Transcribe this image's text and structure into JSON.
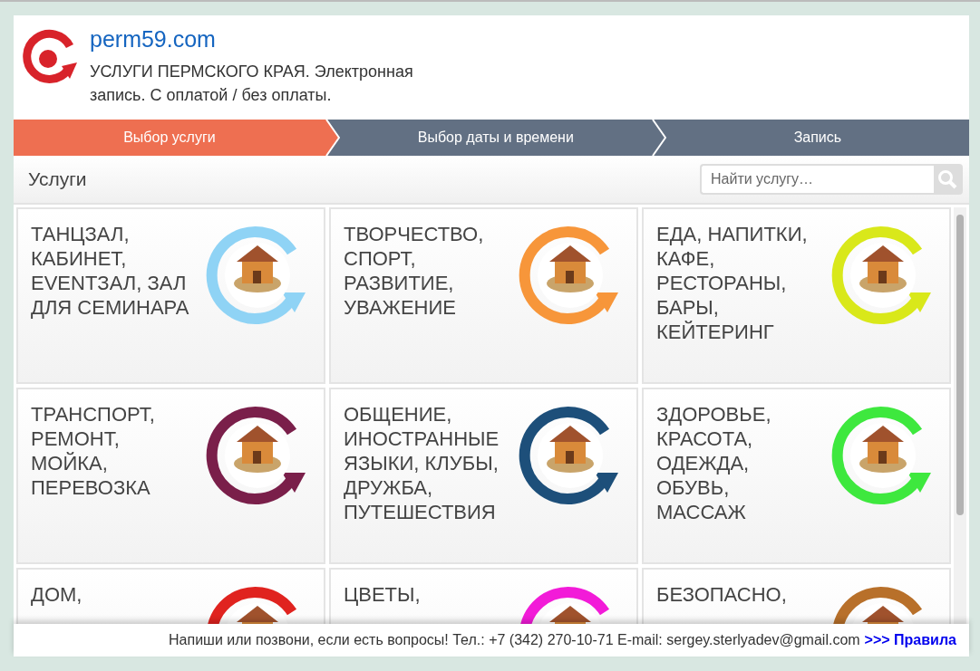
{
  "header": {
    "site": "perm59.com",
    "subtitle": "УСЛУГИ ПЕРМСКОГО КРАЯ. Электронная запись. С оплатой / без оплаты."
  },
  "steps": [
    {
      "label": "Выбор услуги",
      "selected": true
    },
    {
      "label": "Выбор даты и времени",
      "selected": false
    },
    {
      "label": "Запись",
      "selected": false
    }
  ],
  "toolbar": {
    "title": "Услуги",
    "search": {
      "placeholder": "Найти услугу…"
    }
  },
  "services": [
    {
      "name": "ТАНЦЗАЛ, КАБИНЕТ, EVENTЗАЛ, ЗАЛ ДЛЯ СЕМИНАРА",
      "color": "#8fd3f5"
    },
    {
      "name": "ТВОРЧЕСТВО, СПОРТ, РАЗВИТИЕ, УВАЖЕНИЕ",
      "color": "#f7963a"
    },
    {
      "name": "ЕДА, НАПИТКИ, КАФЕ, РЕСТОРАНЫ, БАРЫ, КЕЙТЕРИНГ",
      "color": "#d9e81a"
    },
    {
      "name": "ТРАНСПОРТ, РЕМОНТ, МОЙКА, ПЕРЕВОЗКА",
      "color": "#7a1f4a"
    },
    {
      "name": "ОБЩЕНИЕ, ИНОСТРАННЫЕ ЯЗЫКИ, КЛУБЫ, ДРУЖБА, ПУТЕШЕСТВИЯ",
      "color": "#1d4f7a"
    },
    {
      "name": "ЗДОРОВЬЕ, КРАСОТА, ОДЕЖДА, ОБУВЬ, МАССАЖ",
      "color": "#3ee83e"
    },
    {
      "name": "ДОМ,",
      "color": "#e0231f"
    },
    {
      "name": "ЦВЕТЫ,",
      "color": "#f21bd8"
    },
    {
      "name": "БЕЗОПАСНО,",
      "color": "#b8702a"
    }
  ],
  "footer": {
    "text": "Напиши или позвони, если есть вопросы! Тел.: +7 (342) 270-10-71 E-mail: sergey.sterlyadev@gmail.com",
    "link": ">>> Правила"
  }
}
